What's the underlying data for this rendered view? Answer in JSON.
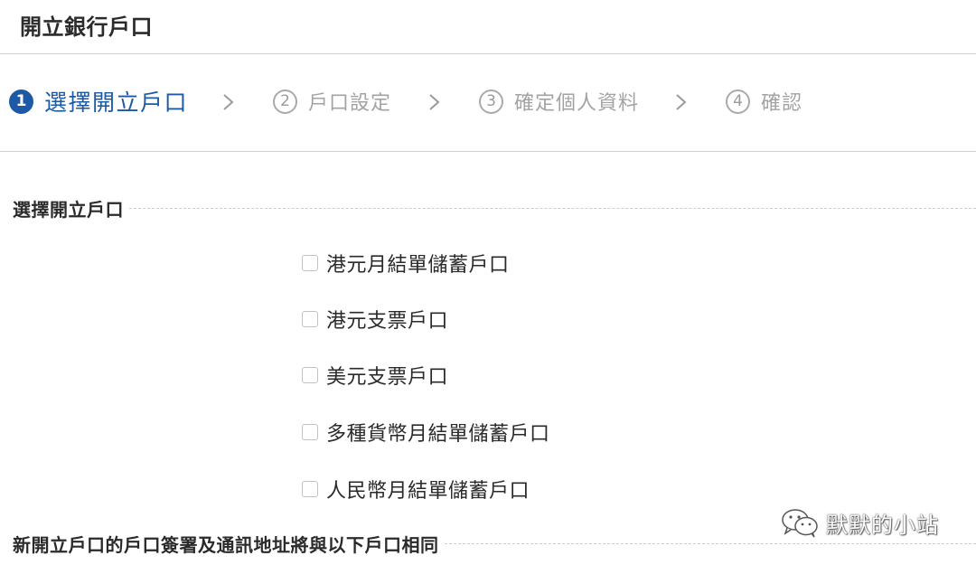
{
  "header": {
    "title": "開立銀行戶口"
  },
  "stepper": {
    "steps": [
      {
        "number": "1",
        "label": "選擇開立戶口",
        "active": true
      },
      {
        "number": "2",
        "label": "戶口設定",
        "active": false
      },
      {
        "number": "3",
        "label": "確定個人資料",
        "active": false
      },
      {
        "number": "4",
        "label": "確認",
        "active": false
      }
    ],
    "separator_icon": "chevron-right-icon"
  },
  "section_select": {
    "title": "選擇開立戶口"
  },
  "account_options": [
    {
      "label": "港元月結單儲蓄戶口",
      "checked": false
    },
    {
      "label": "港元支票戶口",
      "checked": false
    },
    {
      "label": "美元支票戶口",
      "checked": false
    },
    {
      "label": "多種貨幣月結單儲蓄戶口",
      "checked": false
    },
    {
      "label": "人民幣月結單儲蓄戶口",
      "checked": false
    }
  ],
  "section_note": {
    "title": "新開立戶口的戶口簽署及通訊地址將與以下戶口相同"
  },
  "watermark": {
    "icon": "wechat-icon",
    "text": "默默的小站"
  },
  "colors": {
    "accent": "#1d5aa6",
    "inactive": "#a3a3a3",
    "divider": "#cfcfcf"
  }
}
